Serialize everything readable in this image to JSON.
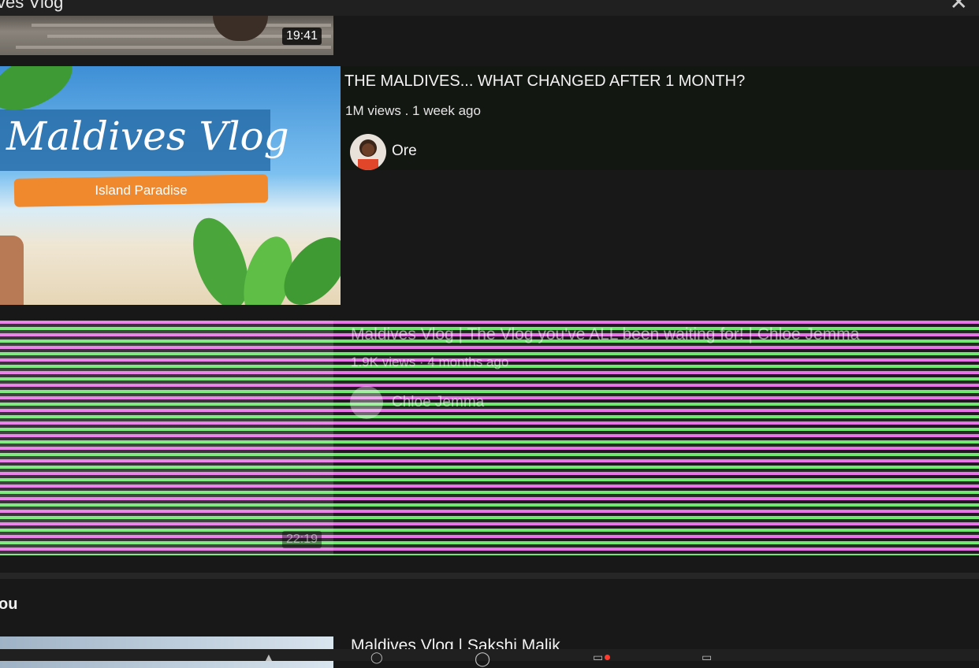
{
  "header": {
    "title": "ves Vlog"
  },
  "videos": [
    {
      "duration": "19:41"
    },
    {
      "title": "THE MALDIVES... WHAT CHANGED AFTER 1 MONTH?",
      "meta": "1M views . 1 week ago",
      "channel": "Ore",
      "thumb_title": "Maldives Vlog",
      "thumb_subtitle": "Island Paradise"
    },
    {
      "title": "Maldives Vlog | The Vlog you've ALL been waiting for! | Chloe Jemma",
      "meta": "1.9K views · 4 months ago",
      "channel": "Chloe Jemma",
      "duration": "22:19"
    }
  ],
  "section": {
    "label": "ou"
  },
  "next_video": {
    "title": "Maldives Vlog | Sakshi Malik"
  },
  "colors": {
    "background": "#181818",
    "accent_orange": "#f0892d",
    "glitch_pink": "#ff7fff",
    "glitch_green": "#7cff7c"
  }
}
